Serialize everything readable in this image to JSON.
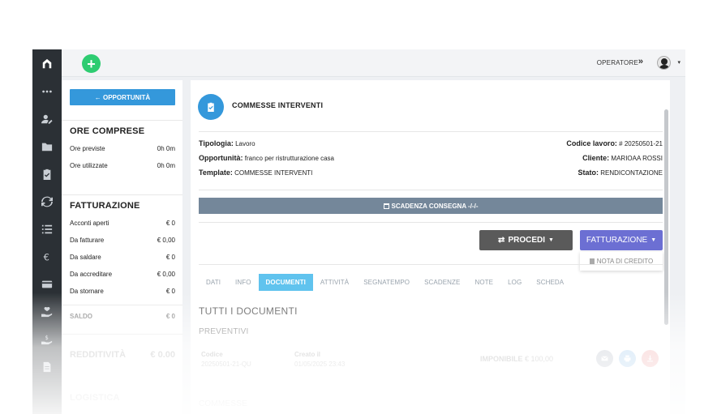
{
  "topbar": {
    "operator_label": "OPERATORE",
    "chevrons": "»",
    "user_caret": "▾"
  },
  "left_panel": {
    "opportunity_button": "← OPPORTUNITÀ",
    "hours": {
      "title": "ORE COMPRESE",
      "rows": [
        {
          "label": "Ore previste",
          "value": "0h 0m"
        },
        {
          "label": "Ore utilizzate",
          "value": "0h 0m"
        }
      ]
    },
    "billing": {
      "title": "FATTURAZIONE",
      "rows": [
        {
          "label": "Acconti aperti",
          "value": "€ 0"
        },
        {
          "label": "Da fatturare",
          "value": "€ 0,00"
        },
        {
          "label": "Da saldare",
          "value": "€ 0"
        },
        {
          "label": "Da accreditare",
          "value": "€ 0,00"
        },
        {
          "label": "Da stornare",
          "value": "€ 0"
        }
      ],
      "total_label": "SALDO",
      "total_value": "€ 0"
    },
    "profitability": {
      "label": "REDDITIVITÀ",
      "value": "€ 0.00"
    },
    "logistics_title": "LOGISTICA"
  },
  "main": {
    "title": "COMMESSE INTERVENTI",
    "left_fields": [
      {
        "key": "Tipologia:",
        "value": "Lavoro"
      },
      {
        "key": "Opportunità:",
        "value": "franco per ristrutturazione casa"
      },
      {
        "key": "Template:",
        "value": "COMMESSE INTERVENTI"
      }
    ],
    "right_fields": [
      {
        "key": "Codice lavoro:",
        "value": "# 20250501-21"
      },
      {
        "key": "Cliente:",
        "value": "MARIOAA ROSSI"
      },
      {
        "key": "Stato:",
        "value": "RENDICONTAZIONE"
      }
    ],
    "deadline_label": "SCADENZA CONSEGNA -/-/-",
    "procedi_label": "PROCEDI",
    "fatturazione_label": "FATTURAZIONE",
    "dropdown_item": "NOTA DI CREDITO",
    "tabs": [
      "DATI",
      "INFO",
      "DOCUMENTI",
      "ATTIVITÀ",
      "SEGNATEMPO",
      "SCADENZE",
      "NOTE",
      "LOG",
      "SCHEDA"
    ],
    "active_tab": "DOCUMENTI",
    "documents_title": "TUTTI I DOCUMENTI",
    "quotes_title": "PREVENTIVI",
    "quote_row": {
      "code_label": "Codice",
      "code_value": "20250501-21-QU",
      "created_label": "Creato il",
      "created_value": "01/05/2025 23:43",
      "taxable_label": "IMPONIBILE",
      "taxable_value": "€ 100,00"
    },
    "next_section_title": "COMMESSE"
  },
  "colors": {
    "primary": "#3498db",
    "success": "#2ecc71",
    "fatturazione": "#6c6fd3",
    "tab_active": "#60c3ee",
    "deadline_bar": "#74879a",
    "rail": "#2b3035"
  },
  "rail_icons": [
    "logo-icon",
    "more-icon",
    "user-edit-icon",
    "folder-icon",
    "clipboard-check-icon",
    "sync-icon",
    "list-icon",
    "euro-icon",
    "card-icon",
    "hand-heart-icon",
    "hand-coin-icon",
    "document-icon"
  ]
}
